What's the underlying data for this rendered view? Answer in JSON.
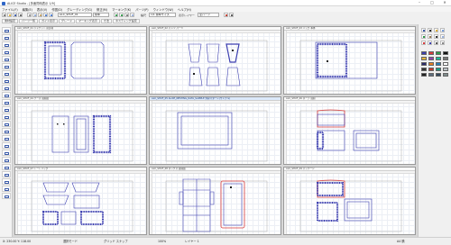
{
  "titlebar": {
    "title": "ALICE Studio - [多面同時表示 1/9]",
    "min": "–",
    "max": "□",
    "close": "✕"
  },
  "menu": [
    "ファイル(F)",
    "編集(E)",
    "表示(V)",
    "作図(D)",
    "グレーディング(G)",
    "修正(M)",
    "マーキング(K)",
    "パーツ(P)",
    "ウィンドウ(W)",
    "ヘルプ(H)"
  ],
  "toolbar2": {
    "combo1": "ALC_SHUF_01",
    "combo2": "標準",
    "text1": "縮尺",
    "combo3": "1/1 標準サイズ",
    "text2": "表示レイヤー",
    "combo4": "全パーツ"
  },
  "toolbar3": {
    "tabs": [
      "素材設定",
      "パーツ一覧",
      "ガイド表示",
      "グレード",
      "マーキング表示",
      "寸法",
      "ネスティング設定"
    ]
  },
  "windows": [
    {
      "title": "ALC_SHUF_01 ジャケット 前身頃"
    },
    {
      "title": "ALC_SHUF_02 パンツ パーツ"
    },
    {
      "title": "ALC_SHUF_03 バッグ 本体"
    },
    {
      "title": "ALC_SHUF_04 ケース 展開図"
    },
    {
      "title": "ALC_SHUF_05 ALICE_NESTING_DATA_SAMPLE 外枠パターン(サンプル)"
    },
    {
      "title": "ALC_SHUF_06 ポーチ 展開"
    },
    {
      "title": "ALC_SHUF_07 トートバッグ"
    },
    {
      "title": "ALC_SHUF_08 ボックス 展開図"
    },
    {
      "title": "ALC_SHUF_09 パッケージ"
    }
  ],
  "status": {
    "coords": "X: 230.00  Y: 118.00",
    "mode": "選択モード",
    "snap": "グリッド スナップ",
    "zoom": "100%",
    "layer": "レイヤー 1",
    "size": "A4 横"
  },
  "colors": {
    "pattern": "#3c3fb0",
    "cut": "#d63a3a",
    "accent": "#2f66c7"
  }
}
